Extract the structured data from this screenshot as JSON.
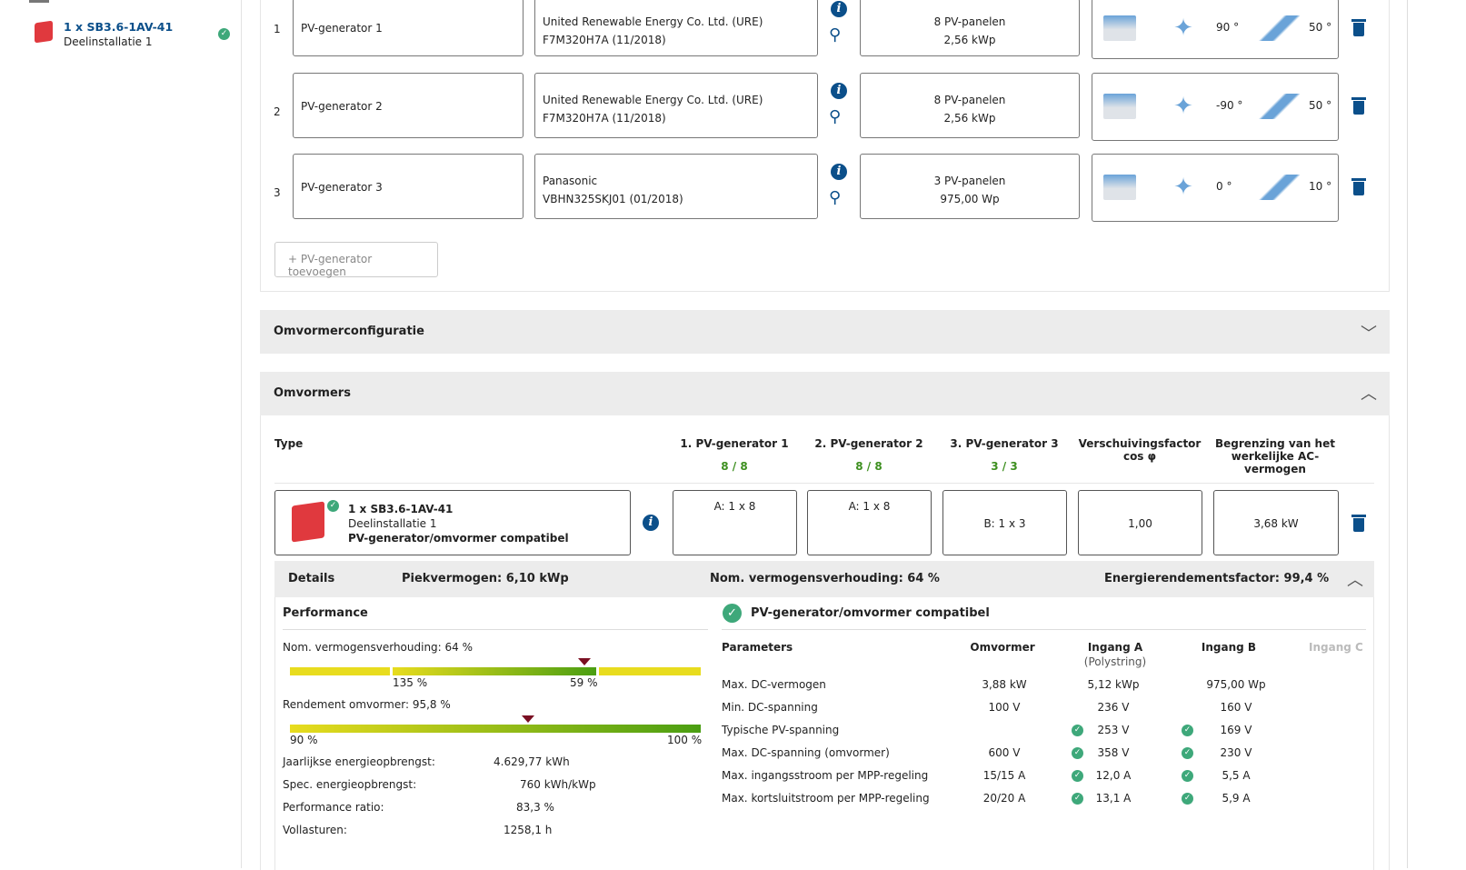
{
  "sidebar": {
    "item": {
      "title": "1 x SB3.6-1AV-41",
      "subtitle": "Deelinstallatie 1"
    }
  },
  "generators": [
    {
      "num": "1",
      "name": "PV-generator 1",
      "maker": "United Renewable Energy Co. Ltd. (URE)",
      "model": "F7M320H7A (11/2018)",
      "panels": "8 PV-panelen",
      "power": "2,56 kWp",
      "azimuth": "90 °",
      "tilt": "50 °"
    },
    {
      "num": "2",
      "name": "PV-generator 2",
      "maker": "United Renewable Energy Co. Ltd. (URE)",
      "model": "F7M320H7A (11/2018)",
      "panels": "8 PV-panelen",
      "power": "2,56 kWp",
      "azimuth": "-90 °",
      "tilt": "50 °"
    },
    {
      "num": "3",
      "name": "PV-generator 3",
      "maker": "Panasonic",
      "model": "VBHN325SKJ01 (01/2018)",
      "panels": "3 PV-panelen",
      "power": "975,00 Wp",
      "azimuth": "0 °",
      "tilt": "10 °"
    }
  ],
  "add_generator": "+ PV-generator toevoegen",
  "sections": {
    "config": "Omvormerconfiguratie",
    "inverters": "Omvormers"
  },
  "table": {
    "headers": {
      "type": "Type",
      "g1": "1. PV-generator 1",
      "g2": "2. PV-generator 2",
      "g3": "3. PV-generator 3",
      "cos": "Verschuivingsfactor cos φ",
      "ac": "Begrenzing van het werkelijke AC-vermogen"
    },
    "counts": {
      "g1": "8 / 8",
      "g2": "8 / 8",
      "g3": "3 / 3"
    },
    "row": {
      "title": "1 x SB3.6-1AV-41",
      "subtitle": "Deelinstallatie 1",
      "status": "PV-generator/omvormer compatibel",
      "g1": "A: 1 x 8",
      "g2": "A: 1 x 8",
      "g3": "B: 1 x 3",
      "cos": "1,00",
      "ac": "3,68 kW"
    }
  },
  "details": {
    "label": "Details",
    "peak": "Piekvermogen: 6,10 kWp",
    "ratio": "Nom. vermogensverhouding: 64 %",
    "efficiency": "Energierendementsfactor: 99,4 %"
  },
  "performance": {
    "title": "Performance",
    "ratio_label": "Nom. vermogensverhouding: 64 %",
    "ratio_low": "135 %",
    "ratio_high": "59 %",
    "eff_label": "Rendement omvormer: 95,8 %",
    "eff_min": "90 %",
    "eff_max": "100 %",
    "eff_value": 95.8,
    "stats": [
      {
        "label": "Jaarlijkse energieopbrengst:",
        "value": "4.629,77 kWh"
      },
      {
        "label": "Spec. energieopbrengst:",
        "value": "760 kWh/kWp"
      },
      {
        "label": "Performance ratio:",
        "value": "83,3 %"
      },
      {
        "label": "Vollasturen:",
        "value": "1258,1 h"
      }
    ]
  },
  "compat": {
    "title": "PV-generator/omvormer compatibel",
    "headers": {
      "param": "Parameters",
      "inv": "Omvormer",
      "a": "Ingang A",
      "a_sub": "(Polystring)",
      "b": "Ingang B",
      "c": "Ingang C"
    },
    "rows": [
      {
        "p": "Max. DC-vermogen",
        "inv": "3,88 kW",
        "a": "5,12 kWp",
        "b": "975,00 Wp",
        "chk": false
      },
      {
        "p": "Min. DC-spanning",
        "inv": "100 V",
        "a": "236 V",
        "b": "160 V",
        "chk": false
      },
      {
        "p": "Typische PV-spanning",
        "inv": "",
        "a": "253 V",
        "b": "169 V",
        "chk": true
      },
      {
        "p": "Max. DC-spanning (omvormer)",
        "inv": "600 V",
        "a": "358 V",
        "b": "230 V",
        "chk": true
      },
      {
        "p": "Max. ingangsstroom per MPP-regeling",
        "inv": "15/15 A",
        "a": "12,0 A",
        "b": "5,5 A",
        "chk": true
      },
      {
        "p": "Max. kortsluitstroom per MPP-regeling",
        "inv": "20/20 A",
        "a": "13,1 A",
        "b": "5,9 A",
        "chk": true
      }
    ]
  },
  "colors": {
    "accent": "#0b4f8a",
    "ok": "#3ea87a",
    "green": "#3d8f1f",
    "marker": "#7a0f22"
  }
}
